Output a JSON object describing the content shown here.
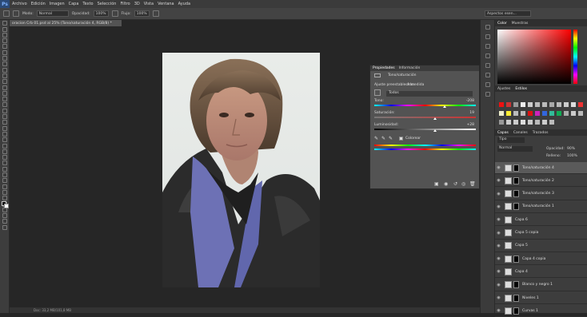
{
  "app": {
    "logo": "Ps"
  },
  "menu": [
    "Archivo",
    "Edición",
    "Imagen",
    "Capa",
    "Texto",
    "Selección",
    "Filtro",
    "3D",
    "Vista",
    "Ventana",
    "Ayuda"
  ],
  "options": {
    "mode_label": "Modo:",
    "mode_value": "Normal",
    "opacity_label": "Opacidad:",
    "opacity_value": "100%",
    "flow_label": "Flujo:",
    "flow_value": "100%",
    "search_placeholder": "Aspectos esen..."
  },
  "document": {
    "tab_title": "oracion Crb 01.psd al 25% (Tono/saturación 4, RGB/8) *",
    "status": "Doc: 33,2 MB/101,8 MB"
  },
  "color_panel": {
    "tabs": [
      "Color",
      "Muestras"
    ],
    "active": "Color"
  },
  "adjust_panel": {
    "tabs": [
      "Ajustes",
      "Estilos"
    ],
    "active": "Estilos"
  },
  "swatch_colors": [
    "#e11",
    "#c33",
    "#999",
    "#eee",
    "#ccc",
    "#bbb",
    "#bbb",
    "#aaa",
    "#bbb",
    "#ccc",
    "#ddd",
    "#e33",
    "#eec",
    "#fe3",
    "#bbb",
    "#bbb",
    "#d11",
    "#c2b",
    "#36d",
    "#3b9",
    "#1a5",
    "#aaa",
    "#ccc",
    "#bbb",
    "#999",
    "#ccc",
    "#ccc",
    "#ddd",
    "#ccc",
    "#bbb",
    "#ccc",
    "#bbb"
  ],
  "layers_panel": {
    "tabs": [
      "Capas",
      "Canales",
      "Trazados"
    ],
    "active": "Capas",
    "filter": "Tipo",
    "blend": "Normal",
    "opacity_label": "Opacidad:",
    "opacity": "90%",
    "fill_label": "Relleno:",
    "fill": "100%",
    "layers": [
      {
        "name": "Tono/saturación 4",
        "selected": true,
        "mask": true
      },
      {
        "name": "Tono/saturación 2",
        "selected": false,
        "mask": true
      },
      {
        "name": "Tono/saturación 3",
        "selected": false,
        "mask": true
      },
      {
        "name": "Tono/saturación 1",
        "selected": false,
        "mask": true
      },
      {
        "name": "Capa 6",
        "selected": false,
        "mask": false
      },
      {
        "name": "Capa 5 copia",
        "selected": false,
        "mask": false
      },
      {
        "name": "Capa 5",
        "selected": false,
        "mask": false
      },
      {
        "name": "Capa 4 copia",
        "selected": false,
        "mask": true
      },
      {
        "name": "Capa 4",
        "selected": false,
        "mask": false
      },
      {
        "name": "Blanco y negro 1",
        "selected": false,
        "mask": true
      },
      {
        "name": "Niveles 1",
        "selected": false,
        "mask": true
      },
      {
        "name": "Curvas 1",
        "selected": false,
        "mask": true
      }
    ]
  },
  "properties": {
    "tabs": [
      "Propiedades",
      "Información"
    ],
    "active": "Propiedades",
    "title": "Tono/saturación",
    "preset_label": "Ajuste preestablecido:",
    "preset_value": "A medida",
    "channel": "Todos",
    "hue_label": "Tono:",
    "hue_value": "-208",
    "hue_pos": 0.69,
    "sat_label": "Saturación:",
    "sat_value": "19",
    "sat_pos": 0.6,
    "light_label": "Luminosidad:",
    "light_value": "+28",
    "light_pos": 0.6,
    "colorize_label": "Colorear",
    "colorize": true
  }
}
